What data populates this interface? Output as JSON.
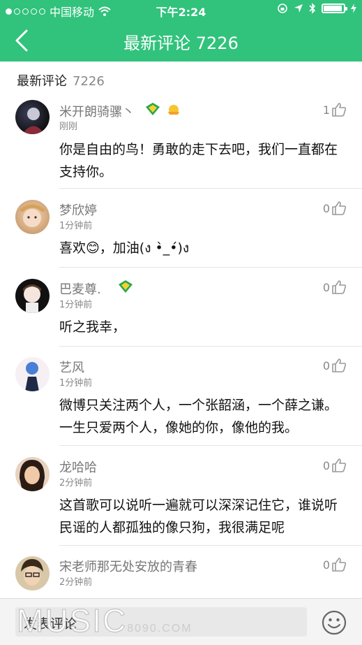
{
  "status_bar": {
    "carrier": "中国移动",
    "time": "下午2:24"
  },
  "header": {
    "title": "最新评论 7226"
  },
  "section": {
    "label": "最新评论",
    "count": "7226"
  },
  "comments": [
    {
      "name": "米开朗骑骡丶",
      "time": "刚刚",
      "likes": "1",
      "text1": "你是自由的鸟！勇敢的走下去吧，我们一直都在",
      "text2": "支持你。"
    },
    {
      "name": "梦欣婷",
      "time": "1分钟前",
      "likes": "0",
      "text1": "喜欢😊，加油(ง •̀_•́)ง",
      "text2": ""
    },
    {
      "name": "巴麦尊.",
      "time": "1分钟前",
      "likes": "0",
      "text1": "听之我幸，",
      "text2": ""
    },
    {
      "name": "艺风",
      "time": "1分钟前",
      "likes": "0",
      "text1": "微博只关注两个人，一个张韶涵，一个薛之谦。",
      "text2": "一生只爱两个人，像她的你，像他的我。"
    },
    {
      "name": "龙哈哈",
      "time": "2分钟前",
      "likes": "0",
      "text1": "这首歌可以说听一遍就可以深深记住它，谁说听",
      "text2": "民谣的人都孤独的像只狗，我很满足呢"
    },
    {
      "name": "宋老师那无处安放的青春",
      "time": "2分钟前",
      "likes": "0",
      "text1": "",
      "text2": ""
    }
  ],
  "composer": {
    "placeholder": "发表评论"
  },
  "watermark": {
    "main": "MUSIC",
    "sub": "8090.COM"
  },
  "colors": {
    "brand": "#31c27c"
  }
}
